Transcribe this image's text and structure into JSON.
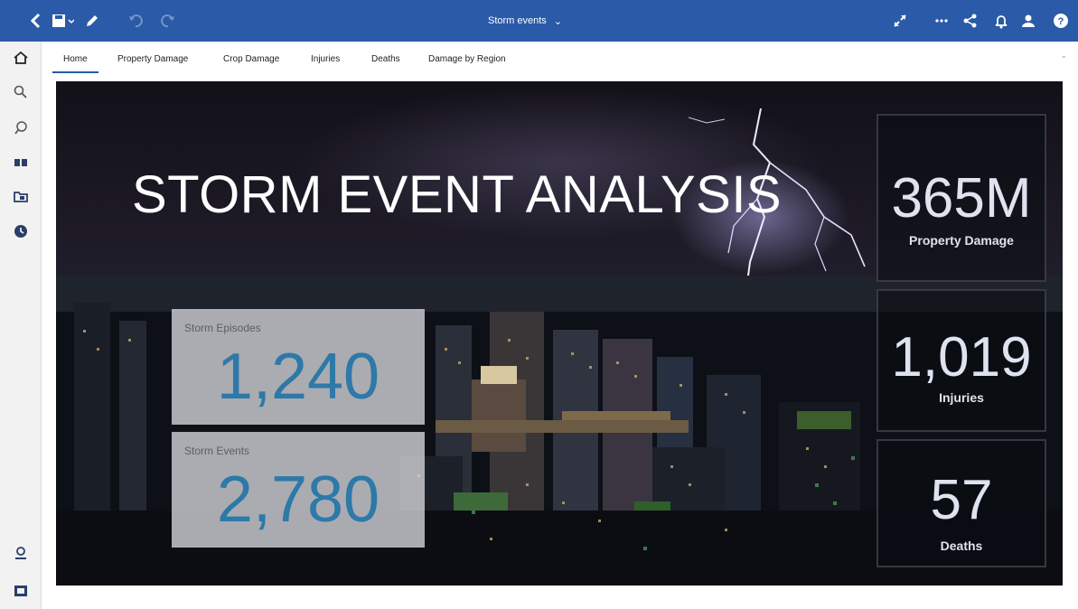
{
  "app": {
    "title": "Storm events"
  },
  "tabs": [
    {
      "label": "Home"
    },
    {
      "label": "Property Damage"
    },
    {
      "label": "Crop Damage"
    },
    {
      "label": "Injuries"
    },
    {
      "label": "Deaths"
    },
    {
      "label": "Damage by Region"
    }
  ],
  "dashboard": {
    "title": "STORM EVENT ANALYSIS",
    "episodes": {
      "label": "Storm Episodes",
      "value": "1,240"
    },
    "events": {
      "label": "Storm Events",
      "value": "2,780"
    },
    "property_damage": {
      "value": "365M",
      "label": "Property Damage"
    },
    "injuries": {
      "value": "1,019",
      "label": "Injuries"
    },
    "deaths": {
      "value": "57",
      "label": "Deaths"
    }
  },
  "colors": {
    "header": "#2a5aa8",
    "kpi_value_blue": "#2d79a8",
    "kpi_value_light": "#dfe3ef"
  },
  "icons": {
    "top": [
      "back-icon",
      "save-icon",
      "edit-icon",
      "undo-icon",
      "redo-icon",
      "expand-icon",
      "more-icon",
      "share-icon",
      "bell-icon",
      "user-icon",
      "help-icon"
    ],
    "rail": [
      "home-icon",
      "search-icon",
      "ask-icon",
      "team-content-icon",
      "my-content-icon",
      "recent-icon",
      "manage-icon",
      "create-icon"
    ]
  }
}
